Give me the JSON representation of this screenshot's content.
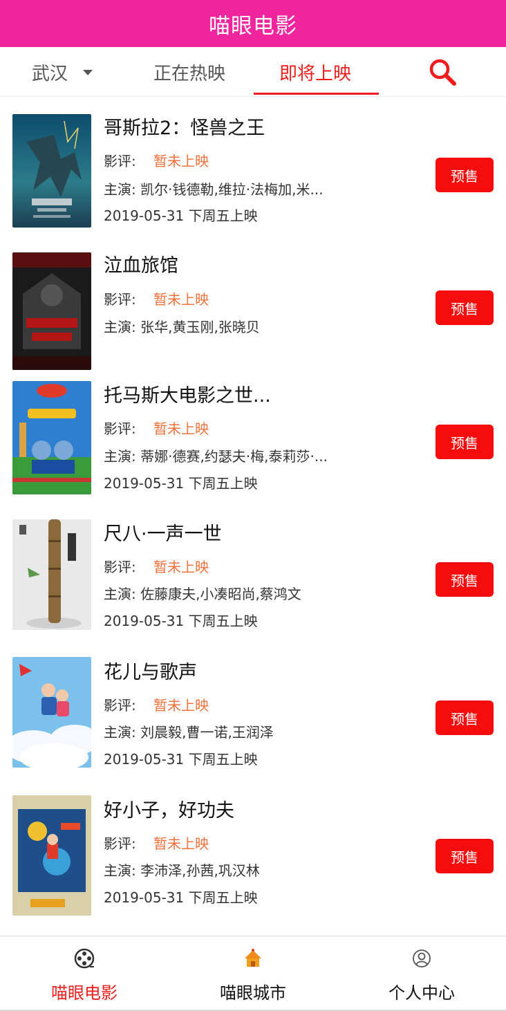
{
  "header": {
    "title": "喵眼电影"
  },
  "tabs": {
    "city": "武汉",
    "now_showing": "正在热映",
    "coming_soon": "即将上映",
    "search_icon": "search-icon",
    "active_color": "#ef1c1c"
  },
  "movies": [
    {
      "title": "哥斯拉2：怪兽之王",
      "rating_label": "影评:",
      "rating": "暂未上映",
      "cast": "主演: 凯尔·钱德勒,维拉·法梅加,米...",
      "date": "2019-05-31 下周五上映",
      "button": "预售"
    },
    {
      "title": "泣血旅馆",
      "rating_label": "影评:",
      "rating": "暂未上映",
      "cast": "主演: 张华,黄玉刚,张晓贝",
      "date": "",
      "button": "预售"
    },
    {
      "title": "托马斯大电影之世...",
      "rating_label": "影评:",
      "rating": "暂未上映",
      "cast": "主演: 蒂娜·德赛,约瑟夫·梅,泰莉莎·...",
      "date": "2019-05-31 下周五上映",
      "button": "预售"
    },
    {
      "title": "尺八·一声一世",
      "rating_label": "影评:",
      "rating": "暂未上映",
      "cast": "主演: 佐藤康夫,小凑昭尚,蔡鸿文",
      "date": "2019-05-31 下周五上映",
      "button": "预售"
    },
    {
      "title": "花儿与歌声",
      "rating_label": "影评:",
      "rating": "暂未上映",
      "cast": "主演: 刘晨毅,曹一诺,王润泽",
      "date": "2019-05-31 下周五上映",
      "button": "预售"
    },
    {
      "title": "好小子，好功夫",
      "rating_label": "影评:",
      "rating": "暂未上映",
      "cast": "主演: 李沛泽,孙茜,巩汉林",
      "date": "2019-05-31 下周五上映",
      "button": "预售"
    }
  ],
  "bottom_nav": [
    {
      "label": "喵眼电影",
      "icon": "film-reel-icon",
      "active": true
    },
    {
      "label": "喵眼城市",
      "icon": "house-icon",
      "active": false
    },
    {
      "label": "个人中心",
      "icon": "user-icon",
      "active": false
    }
  ],
  "colors": {
    "brand": "#f0259e",
    "accent": "#ef1c1c",
    "rating": "#f1703b",
    "button": "#f60c0c"
  }
}
